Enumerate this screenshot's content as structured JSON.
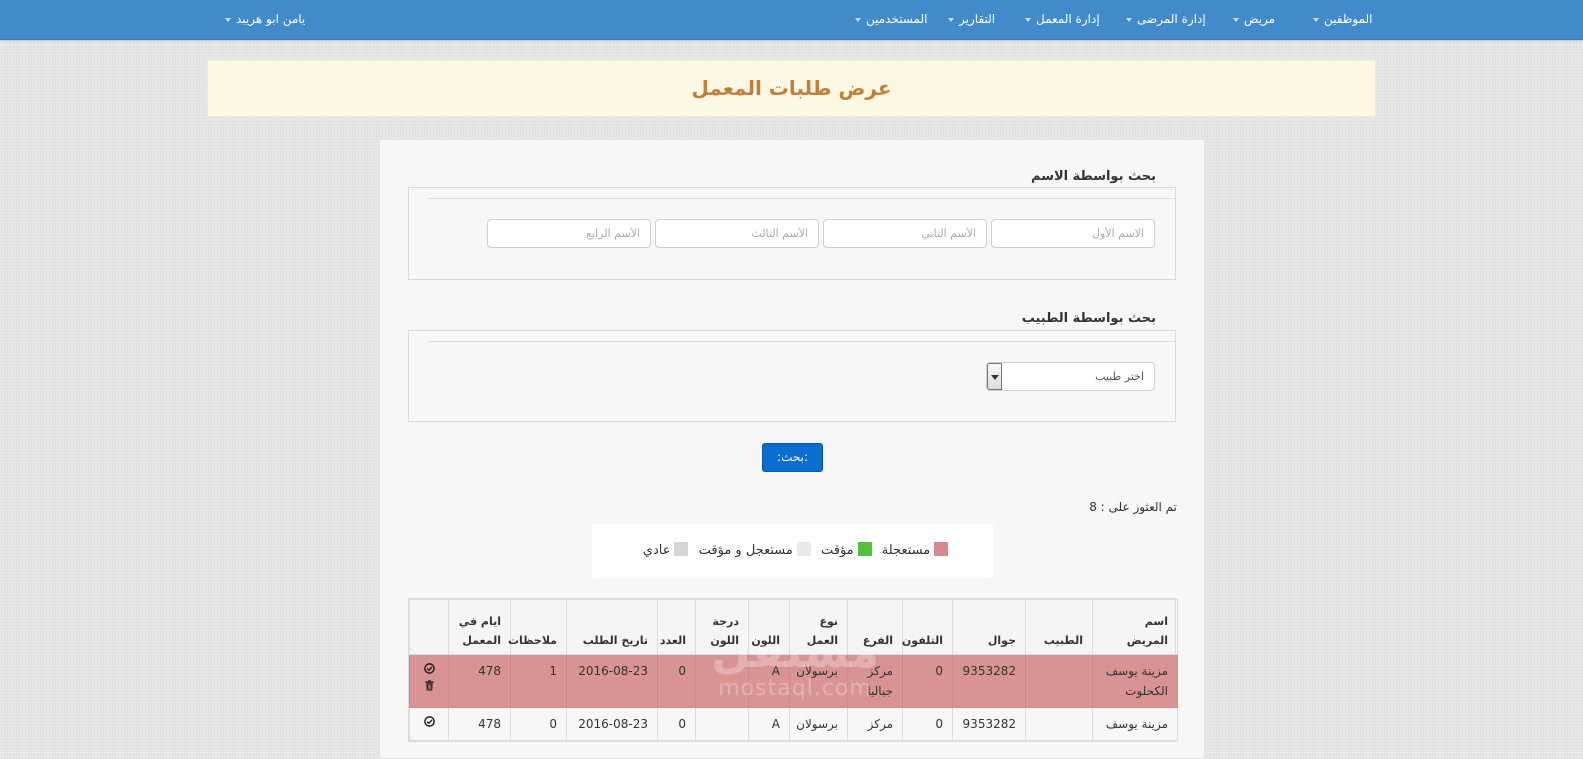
{
  "navbar": {
    "items": [
      {
        "label": "الموظفين"
      },
      {
        "label": "مريض"
      },
      {
        "label": "إدارة المرضى"
      },
      {
        "label": "إدارة المعمل"
      },
      {
        "label": "التقارير"
      },
      {
        "label": "المستخدمين"
      }
    ],
    "user": "يامن ابو هريبد"
  },
  "page_title": "عرض طلبات المعمل",
  "name_search": {
    "title": "بحث بواسطة الاسم",
    "first_placeholder": "الاسم الأول",
    "second_placeholder": "الأسم الثاني",
    "third_placeholder": "الأسم الثالث",
    "fourth_placeholder": "الأسم الرابع"
  },
  "doctor_search": {
    "title": "بحث بواسطة الطبيب",
    "select_value": "اختر طبيب"
  },
  "search_button": ":بحث:",
  "results": {
    "label": "تم العثور على :",
    "count": "8"
  },
  "legend": {
    "items": [
      {
        "label": "مستعجلة",
        "color": "#d58a8d"
      },
      {
        "label": "مؤقت",
        "color": "#55c03a"
      },
      {
        "label": "مستعجل و مؤقت",
        "color": "#e9e9e9"
      },
      {
        "label": "عادي",
        "color": "#d5d5d5"
      }
    ]
  },
  "table": {
    "headers": {
      "patient": "اسم المريض",
      "doctor": "الطبيب",
      "mobile": "جوال",
      "phone": "التلفون",
      "branch": "الفرع",
      "work_type": "نوع العمل",
      "color": "اللون",
      "shade": "درجة اللون",
      "count": "العدد",
      "date": "تاريخ الطلب",
      "notes": "ملاحظات",
      "days": "ايام في المعمل"
    },
    "rows": [
      {
        "patient": "مزينة يوسف الكحلوت",
        "doctor": "",
        "mobile": "9353282",
        "phone": "0",
        "branch": "مركز جباليا",
        "work_type": "برسولان",
        "color": "A",
        "shade": "",
        "count": "0",
        "date": "2016-08-23",
        "notes": "1",
        "days": "478"
      },
      {
        "patient": "مزينة يوسف",
        "doctor": "",
        "mobile": "9353282",
        "phone": "0",
        "branch": "مركز",
        "work_type": "برسولان",
        "color": "A",
        "shade": "",
        "count": "0",
        "date": "2016-08-23",
        "notes": "0",
        "days": "478"
      }
    ]
  },
  "watermark": {
    "arabic": "مستقل",
    "latin": "mostaql.com"
  }
}
